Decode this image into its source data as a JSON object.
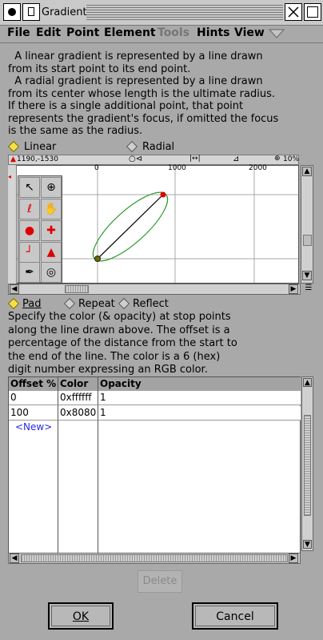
{
  "window": {
    "title": "Gradient"
  },
  "menu": [
    {
      "label": "File",
      "disabled": false
    },
    {
      "label": "Edit",
      "disabled": false
    },
    {
      "label": "Point",
      "disabled": false
    },
    {
      "label": "Element",
      "disabled": false
    },
    {
      "label": "Tools",
      "disabled": true
    },
    {
      "label": "Hints",
      "disabled": false
    },
    {
      "label": "View",
      "disabled": false
    }
  ],
  "description": [
    "  A linear gradient is represented by a line drawn",
    "from its start point to its end point.",
    "  A radial gradient is represented by a line drawn",
    "from its center whose length is the ultimate radius.",
    "If there is a single additional point, that point",
    "represents the gradient's focus, if omitted the focus",
    "is the same as the radius."
  ],
  "gradient_type": {
    "linear": "Linear",
    "radial": "Radial",
    "selected": "Linear"
  },
  "ruler": {
    "coords": "1190,-1530",
    "zoom": "10%",
    "mark_1000": "1000",
    "mark_2000": "2000",
    "mark_0": "0"
  },
  "spread": {
    "pad": "Pad",
    "repeat": "Repeat",
    "reflect": "Reflect",
    "selected": "Pad"
  },
  "stops_description": [
    "Specify the color (& opacity) at stop points",
    "along the line drawn above. The offset is a",
    "percentage of the distance from the start to",
    "the end of the line. The color is a 6 (hex)",
    "digit number expressing an RGB color."
  ],
  "table": {
    "headers": [
      "Offset %",
      "Color",
      "Opacity"
    ],
    "rows": [
      [
        "0",
        "0xffffff",
        "1"
      ],
      [
        "100",
        "0x8080",
        "1"
      ]
    ],
    "new_label": "<New>"
  },
  "buttons": {
    "delete": "Delete",
    "ok": "OK",
    "cancel": "Cancel"
  },
  "colors": {
    "selected_radio": "#f5e04a",
    "new_link": "#2a2ae0",
    "endpoint": "#e00000",
    "ellipse": "#2a9a2a"
  }
}
